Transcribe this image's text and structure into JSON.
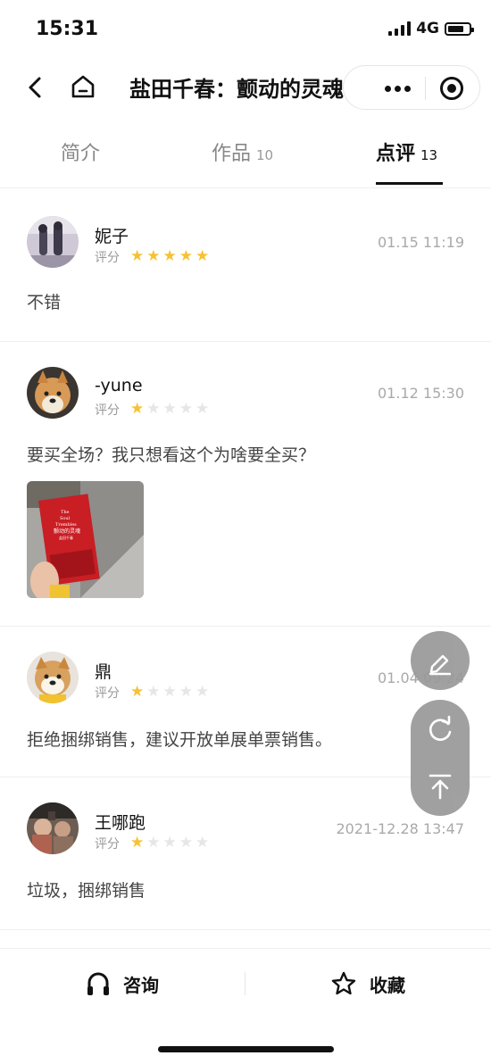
{
  "status_bar": {
    "time": "15:31",
    "network": "4G",
    "battery_level": 0.78
  },
  "nav": {
    "title": "盐田千春：颤动的灵魂"
  },
  "tabs": [
    {
      "label": "简介",
      "count": ""
    },
    {
      "label": "作品",
      "count": "10"
    },
    {
      "label": "点评",
      "count": "13",
      "active": true
    }
  ],
  "reviews": [
    {
      "name": "妮子",
      "rating_label": "评分",
      "rating": 5,
      "date": "01.15 11:19",
      "content": "不错",
      "has_photo": false
    },
    {
      "name": "-yune",
      "rating_label": "评分",
      "rating": 1,
      "date": "01.12 15:30",
      "content": "要买全场？我只想看这个为啥要全买？",
      "has_photo": true,
      "photo_text": [
        "The",
        "Soul",
        "Trembles",
        "颤动的灵魂",
        "盐田千春"
      ]
    },
    {
      "name": "鼎",
      "rating_label": "评分",
      "rating": 1,
      "date": "01.04 09:24",
      "content": "拒绝捆绑销售，建议开放单展单票销售。",
      "has_photo": false
    },
    {
      "name": "王哪跑",
      "rating_label": "评分",
      "rating": 1,
      "date": "2021-12.28 13:47",
      "content": "垃圾，捆绑销售",
      "has_photo": false
    }
  ],
  "fab": {
    "icons": [
      "edit-icon",
      "refresh-icon",
      "back-to-top-icon"
    ]
  },
  "bottom_bar": {
    "consult_label": "咨询",
    "favorite_label": "收藏"
  },
  "colors": {
    "star_on": "#f6c231",
    "star_off": "#e6e6e6",
    "accent": "#111111"
  }
}
